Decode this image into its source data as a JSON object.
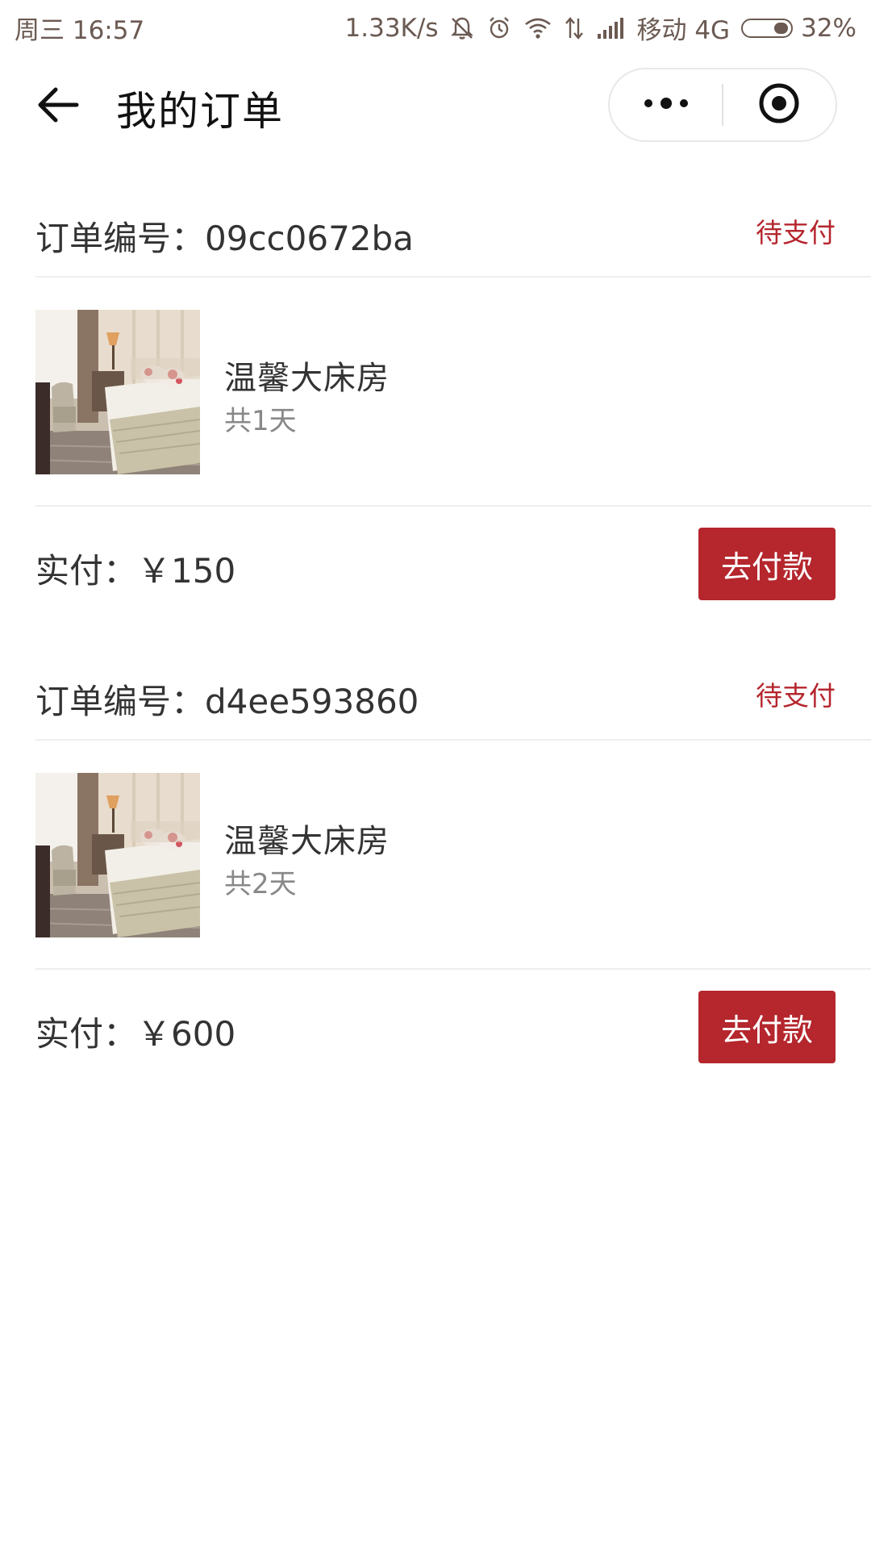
{
  "status_bar": {
    "day_time": "周三 16:57",
    "net_speed": "1.33K/s",
    "carrier": "移动 4G",
    "battery_percent": "32%",
    "battery_level": 0.32
  },
  "nav": {
    "title": "我的订单"
  },
  "orders": [
    {
      "number_text": "订单编号：09cc0672ba",
      "status": "待支付",
      "room_name": "温馨大床房",
      "days": "共1天",
      "paid_text": "实付：￥150",
      "pay_label": "去付款"
    },
    {
      "number_text": "订单编号：d4ee593860",
      "status": "待支付",
      "room_name": "温馨大床房",
      "days": "共2天",
      "paid_text": "实付：￥600",
      "pay_label": "去付款"
    }
  ],
  "colors": {
    "accent": "#b5262d",
    "status_bar_text": "#6b5a52",
    "divider": "#eeeeee"
  }
}
